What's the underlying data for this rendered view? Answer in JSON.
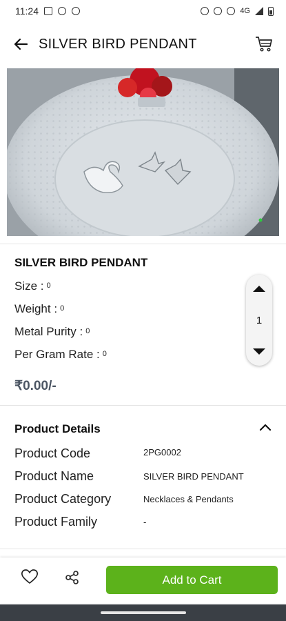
{
  "status_bar": {
    "time": "11:24",
    "network": "4G"
  },
  "app_bar": {
    "title": "SILVER BIRD PENDANT"
  },
  "product": {
    "name": "SILVER BIRD PENDANT",
    "size_label": "Size :",
    "size_value": "0",
    "weight_label": "Weight :",
    "weight_value": "0",
    "purity_label": "Metal Purity :",
    "purity_value": "0",
    "rate_label": "Per Gram Rate :",
    "rate_value": "0",
    "price": "₹0.00/-",
    "quantity": "1"
  },
  "details": {
    "title": "Product Details",
    "rows": [
      {
        "label": "Product Code",
        "value": "2PG0002"
      },
      {
        "label": "Product Name",
        "value": "SILVER BIRD PENDANT"
      },
      {
        "label": "Product Category",
        "value": "Necklaces & Pendants"
      },
      {
        "label": "Product Family",
        "value": "-"
      }
    ]
  },
  "bottom": {
    "add_to_cart": "Add to Cart"
  },
  "colors": {
    "accent": "#5cb21b",
    "price": "#4b5563",
    "nav": "#3a3f45"
  },
  "icons": [
    "back-arrow-icon",
    "cart-icon",
    "wishlist-heart-icon",
    "share-icon",
    "chevron-up-icon"
  ]
}
